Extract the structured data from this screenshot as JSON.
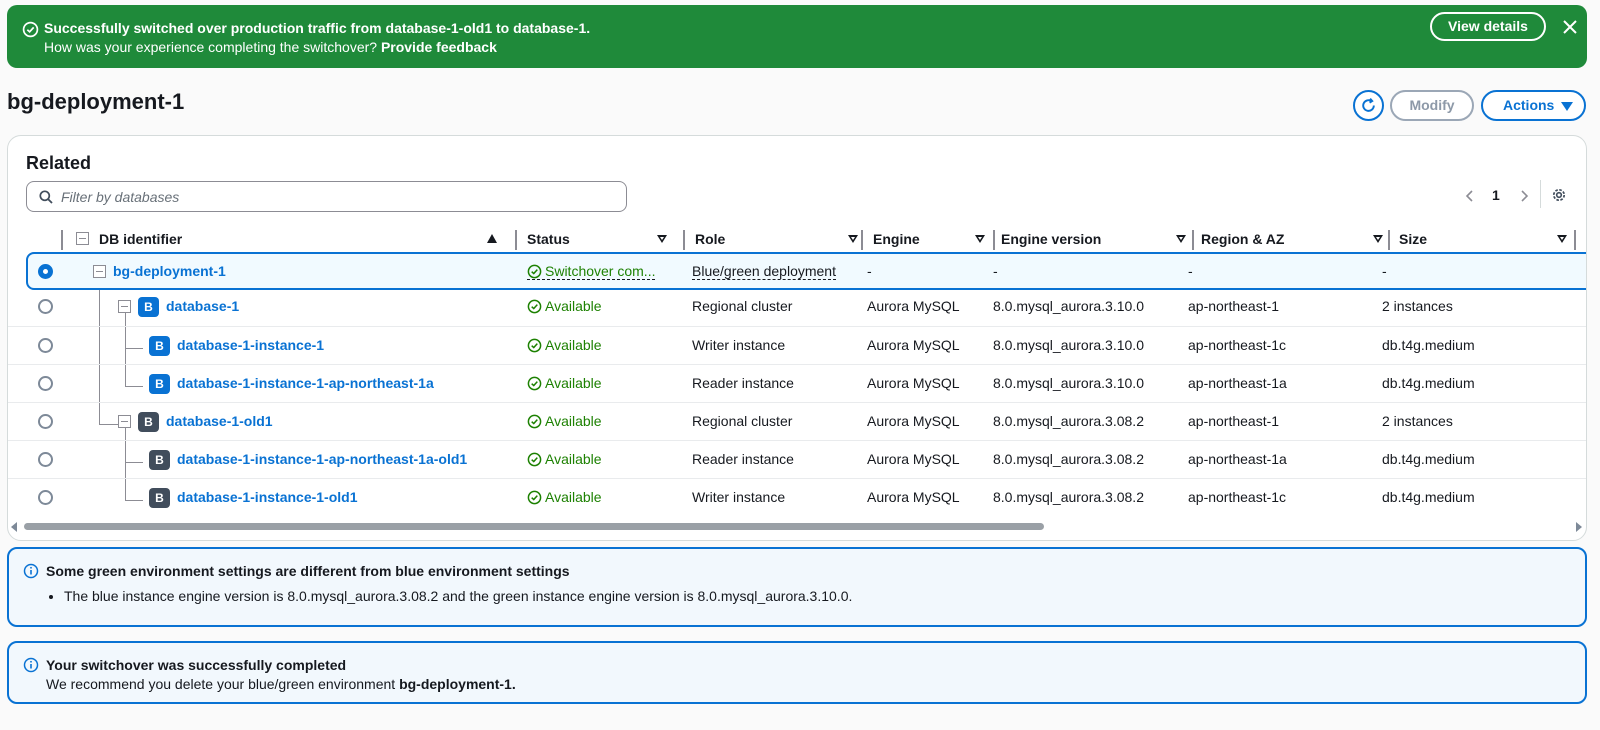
{
  "banner": {
    "title": "Successfully switched over production traffic from database-1-old1 to database-1.",
    "question": "How was your experience completing the switchover?",
    "feedback_link": "Provide feedback",
    "view_details": "View details"
  },
  "header": {
    "title": "bg-deployment-1",
    "modify": "Modify",
    "actions": "Actions"
  },
  "related": {
    "title": "Related",
    "filter_placeholder": "Filter by databases",
    "page": "1",
    "columns": {
      "db_identifier": "DB identifier",
      "status": "Status",
      "role": "Role",
      "engine": "Engine",
      "engine_version": "Engine version",
      "region_az": "Region & AZ",
      "size": "Size"
    },
    "rows": [
      {
        "id": "bg-deployment-1",
        "status": "Switchover com...",
        "role": "Blue/green deployment",
        "engine": "-",
        "version": "-",
        "region": "-",
        "size": "-",
        "badge": ""
      },
      {
        "id": "database-1",
        "status": "Available",
        "role": "Regional cluster",
        "engine": "Aurora MySQL",
        "version": "8.0.mysql_aurora.3.10.0",
        "region": "ap-northeast-1",
        "size": "2 instances",
        "badge": "B"
      },
      {
        "id": "database-1-instance-1",
        "status": "Available",
        "role": "Writer instance",
        "engine": "Aurora MySQL",
        "version": "8.0.mysql_aurora.3.10.0",
        "region": "ap-northeast-1c",
        "size": "db.t4g.medium",
        "badge": "B"
      },
      {
        "id": "database-1-instance-1-ap-northeast-1a",
        "status": "Available",
        "role": "Reader instance",
        "engine": "Aurora MySQL",
        "version": "8.0.mysql_aurora.3.10.0",
        "region": "ap-northeast-1a",
        "size": "db.t4g.medium",
        "badge": "B"
      },
      {
        "id": "database-1-old1",
        "status": "Available",
        "role": "Regional cluster",
        "engine": "Aurora MySQL",
        "version": "8.0.mysql_aurora.3.08.2",
        "region": "ap-northeast-1",
        "size": "2 instances",
        "badge": "B"
      },
      {
        "id": "database-1-instance-1-ap-northeast-1a-old1",
        "status": "Available",
        "role": "Reader instance",
        "engine": "Aurora MySQL",
        "version": "8.0.mysql_aurora.3.08.2",
        "region": "ap-northeast-1a",
        "size": "db.t4g.medium",
        "badge": "B"
      },
      {
        "id": "database-1-instance-1-old1",
        "status": "Available",
        "role": "Writer instance",
        "engine": "Aurora MySQL",
        "version": "8.0.mysql_aurora.3.08.2",
        "region": "ap-northeast-1c",
        "size": "db.t4g.medium",
        "badge": "B"
      }
    ]
  },
  "alert_settings": {
    "title": "Some green environment settings are different from blue environment settings",
    "bullet": "The blue instance engine version is 8.0.mysql_aurora.3.08.2 and the green instance engine version is 8.0.mysql_aurora.3.10.0."
  },
  "alert_done": {
    "title": "Your switchover was successfully completed",
    "body_prefix": "We recommend you delete your blue/green environment",
    "body_name": "bg-deployment-1."
  },
  "colors": {
    "success": "#1f8a3a",
    "accent": "#0972d3",
    "available": "#1d8102",
    "info_bg": "#f2f8fd"
  }
}
